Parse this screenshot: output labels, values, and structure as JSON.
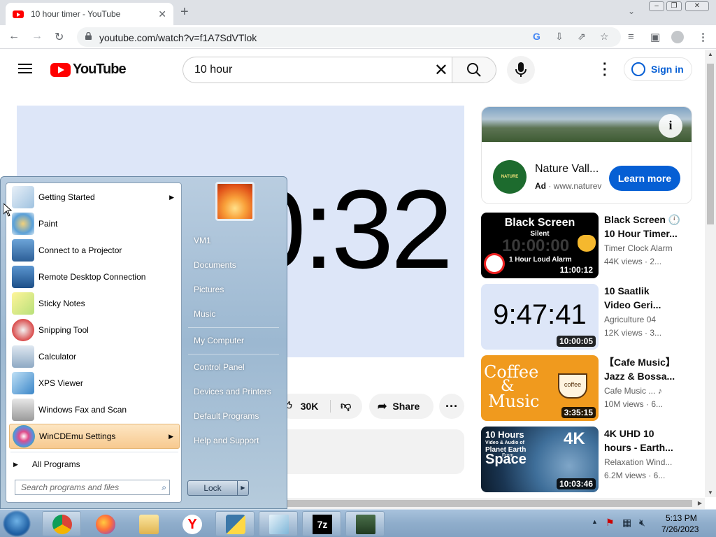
{
  "browser": {
    "tab_title": "10 hour timer - YouTube",
    "url": "youtube.com/watch?v=f1A7SdVTlok"
  },
  "youtube": {
    "logo_text": "YouTube",
    "search_value": "10 hour",
    "sign_in": "Sign in"
  },
  "player": {
    "timer_display": "0:32"
  },
  "actions": {
    "likes": "30K",
    "share": "Share"
  },
  "ad": {
    "title": "Nature Vall...",
    "badge": "Ad",
    "domain": "· www.naturev",
    "logo_text": "NATURE VALLEY",
    "cta": "Learn more"
  },
  "recommendations": [
    {
      "title_l1": "Black Screen 🕛",
      "title_l2": "10 Hour Timer...",
      "channel": "Timer Clock Alarm",
      "views": "44K views · 2...",
      "duration": "11:00:12",
      "thumb_title": "Black Screen",
      "thumb_sub": "Silent",
      "thumb_clock": "10:00:00",
      "thumb_alarm": "1 Hour Loud Alarm"
    },
    {
      "title_l1": "10 Saatlik",
      "title_l2": "Video Geri...",
      "channel": "Agriculture 04",
      "views": "12K views · 3...",
      "duration": "10:00:05",
      "thumb_clock": "9:47:41"
    },
    {
      "title_l1": "【Cafe Music】",
      "title_l2": "Jazz & Bossa...",
      "channel": "Cafe Music ... ♪",
      "views": "10M views · 6...",
      "duration": "3:35:15",
      "thumb_l1": "Coffee",
      "thumb_l2": "&",
      "thumb_l3": "Music",
      "thumb_cup": "coffee"
    },
    {
      "title_l1": "4K UHD 10",
      "title_l2": "hours - Earth...",
      "channel": "Relaxation Wind...",
      "views": "6.2M views · 6...",
      "duration": "10:03:46",
      "thumb_l1": "10 Hours",
      "thumb_l2": "Video & Audio of",
      "thumb_l3": "Planet Earth",
      "thumb_l4": "From",
      "thumb_l5": "Space",
      "thumb_badge": "4K"
    }
  ],
  "start_menu": {
    "left_items": [
      {
        "label": "Getting Started",
        "submenu": true
      },
      {
        "label": "Paint"
      },
      {
        "label": "Connect to a Projector"
      },
      {
        "label": "Remote Desktop Connection"
      },
      {
        "label": "Sticky Notes"
      },
      {
        "label": "Snipping Tool"
      },
      {
        "label": "Calculator"
      },
      {
        "label": "XPS Viewer"
      },
      {
        "label": "Windows Fax and Scan"
      },
      {
        "label": "WinCDEmu Settings",
        "submenu": true
      }
    ],
    "all_programs": "All Programs",
    "search_placeholder": "Search programs and files",
    "right_items": [
      "VM1",
      "Documents",
      "Pictures",
      "Music",
      "My Computer",
      "Control Panel",
      "Devices and Printers",
      "Default Programs",
      "Help and Support"
    ],
    "lock": "Lock"
  },
  "taskbar": {
    "clock_time": "5:13 PM",
    "clock_date": "7/26/2023",
    "apps": [
      "chrome",
      "firefox",
      "explorer",
      "yandex",
      "python",
      "notepad",
      "7zip",
      "network"
    ]
  }
}
